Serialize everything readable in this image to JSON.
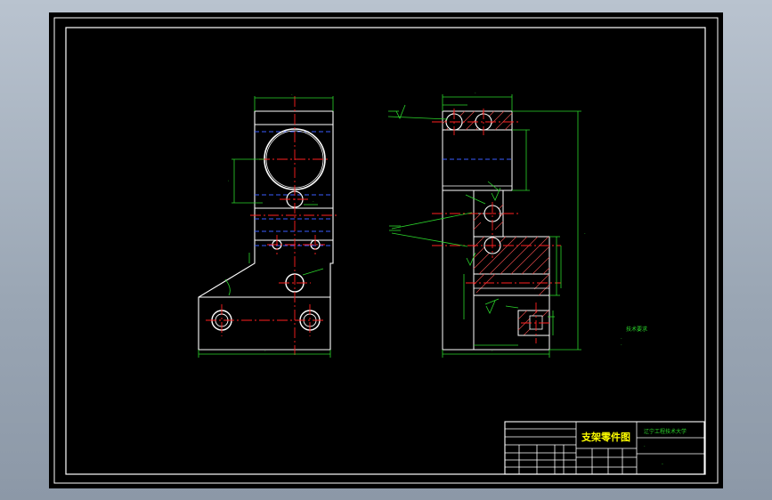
{
  "drawing": {
    "title_block": {
      "drawing_title": "支架零件图",
      "school": "辽宁工程技术大学",
      "subtitle": "-",
      "part_label": "-"
    },
    "tech_requirements": {
      "heading": "技术要求",
      "lines": [
        "-",
        "-"
      ]
    },
    "colors": {
      "background": "#000000",
      "border": "#ffffff",
      "outline": "#ffffff",
      "centerline": "#ff2020",
      "hidden_line": "#3a5cff",
      "dimension": "#2bd62b",
      "hatch": "#e04848",
      "title_text": "#ffff00"
    }
  }
}
